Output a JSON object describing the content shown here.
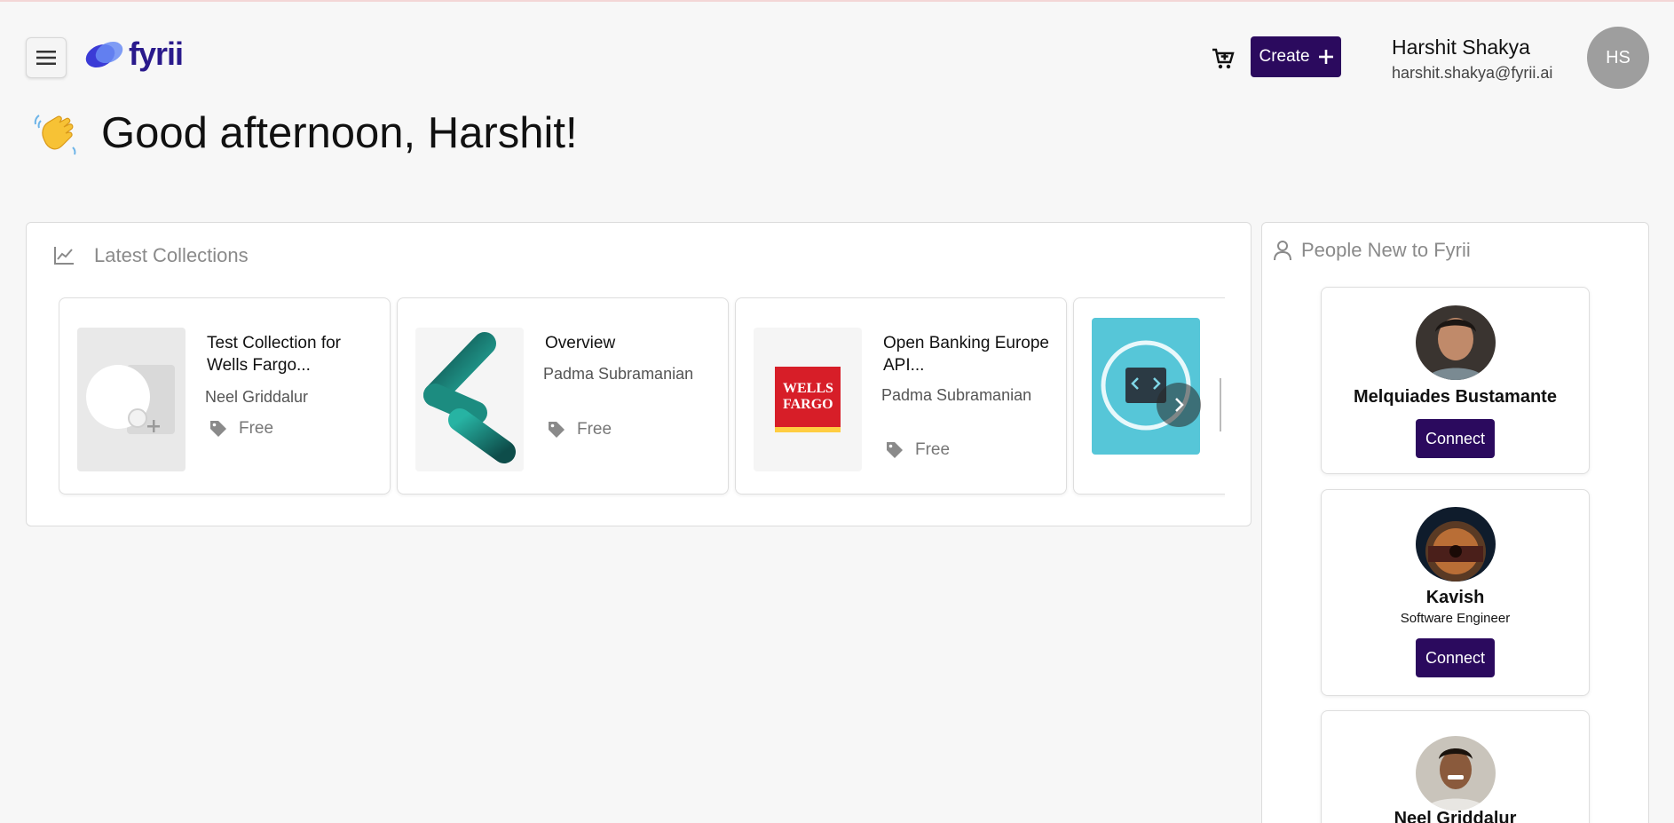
{
  "header": {
    "menu_icon": "hamburger-menu-icon",
    "logo_text": "fyrii",
    "cart_icon": "cart-add-icon",
    "create_label": "Create",
    "create_icon": "plus-icon",
    "user_name": "Harshit Shakya",
    "user_email": "harshit.shakya@fyrii.ai",
    "user_initials": "HS"
  },
  "greeting": {
    "emoji_icon": "waving-hand-icon",
    "text": "Good afternoon, Harshit!"
  },
  "collections": {
    "icon": "line-chart-icon",
    "title": "Latest Collections",
    "items": [
      {
        "title": "Test Collection for Wells Fargo...",
        "author": "Neel Griddalur",
        "price": "Free"
      },
      {
        "title": "Overview",
        "author": "Padma Subramanian",
        "price": "Free"
      },
      {
        "title": "Open Banking Europe API...",
        "author": "Padma Subramanian",
        "price": "Free"
      }
    ],
    "wells_fargo_logo_text": "WELLS FARGO",
    "next_icon": "chevron-right-icon"
  },
  "people": {
    "icon": "person-icon",
    "title": "People New to Fyrii",
    "items": [
      {
        "name": "Melquiades Bustamante",
        "role": "",
        "connect": "Connect"
      },
      {
        "name": "Kavish",
        "role": "Software Engineer",
        "connect": "Connect"
      },
      {
        "name": "Neel Griddalur",
        "role": "",
        "connect": ""
      }
    ]
  },
  "colors": {
    "brand_dark": "#2b0a5e",
    "logo_blue": "#2a1a8c",
    "page_bg": "#f7f7f7"
  }
}
